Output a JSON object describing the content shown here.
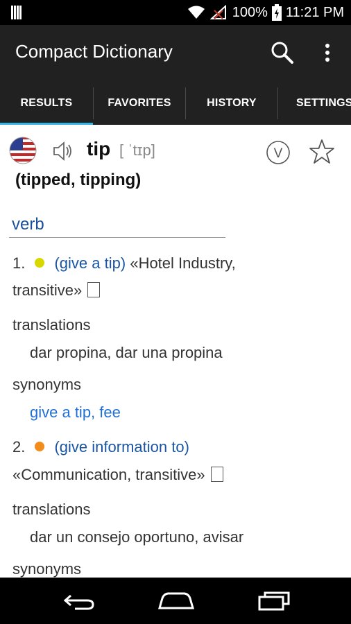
{
  "status_bar": {
    "battery": "100%",
    "time": "11:21 PM"
  },
  "app_bar": {
    "title": "Compact Dictionary",
    "search_icon": "search-icon",
    "more_icon": "overflow-menu-icon"
  },
  "tabs": [
    {
      "label": "RESULTS",
      "active": true
    },
    {
      "label": "FAVORITES",
      "active": false
    },
    {
      "label": "HISTORY",
      "active": false
    },
    {
      "label": "SETTINGS",
      "active": false
    }
  ],
  "colors": {
    "accent": "#33b5e5",
    "appbar": "#212121",
    "pos_blue": "#1a4f9c",
    "synonym_blue": "#1f6fd6",
    "dot1": "#d8d800",
    "dot2": "#f28c1b"
  },
  "entry": {
    "word": "tip",
    "ipa": "[ ˈtɪp]",
    "forms": "(tipped, tipping)",
    "badge": "V",
    "pos": "verb",
    "senses": [
      {
        "number": "1.",
        "gloss": "(give a tip)",
        "tags_line1": "«Hotel Industry,",
        "tags_line2": "transitive»",
        "translations_label": "translations",
        "translations": "dar propina, dar una propina",
        "synonyms_label": "synonyms",
        "synonyms": "give a tip, fee"
      },
      {
        "number": "2.",
        "gloss": "(give information to)",
        "tags_line1": "«Communication, transitive»",
        "translations_label": "translations",
        "translations": "dar un consejo oportuno, avisar",
        "synonyms_label": "synonyms"
      }
    ]
  }
}
